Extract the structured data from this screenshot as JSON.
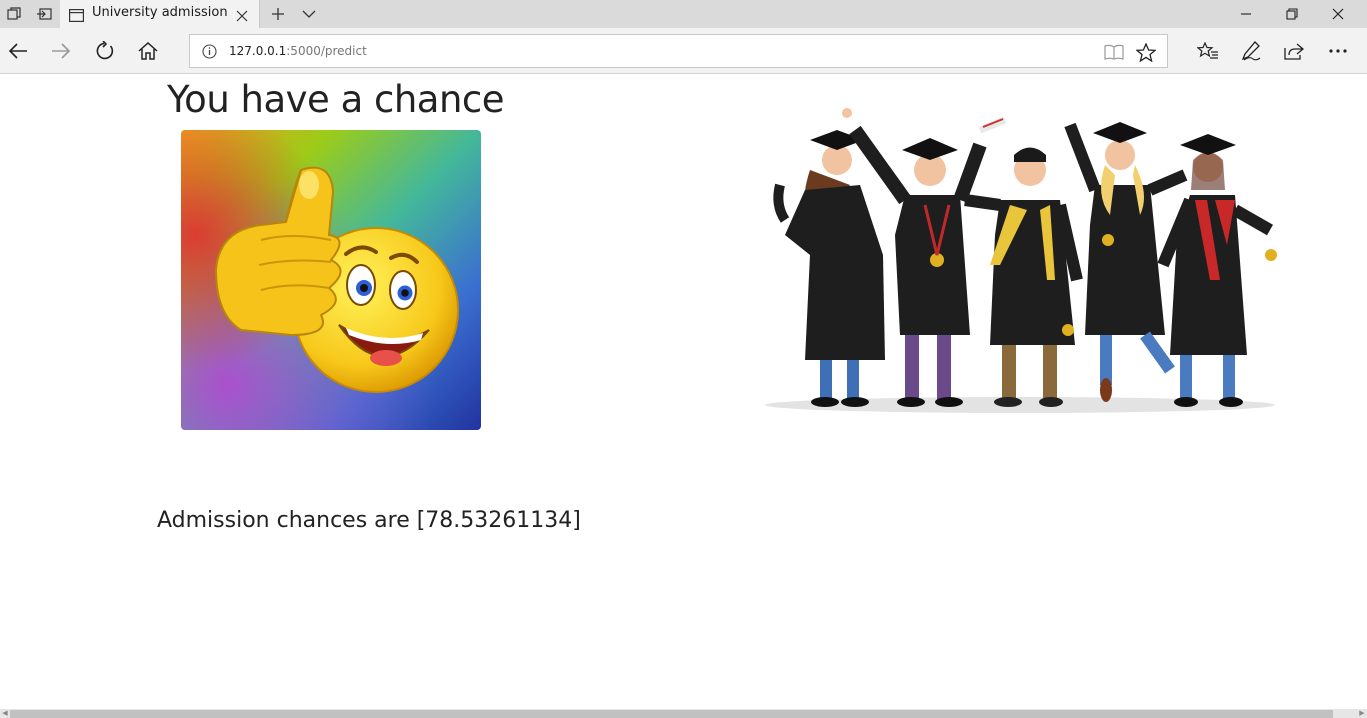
{
  "browser": {
    "tab": {
      "title": "University admission pr"
    },
    "address_bar": {
      "host": "127.0.0.1",
      "path": ":5000/predict"
    }
  },
  "icons": {
    "tab_actions": "tab-actions-icon",
    "set_aside": "set-aside-tabs-icon",
    "favicon": "page-icon",
    "close_tab": "close-icon",
    "new_tab": "plus-icon",
    "tab_preview": "chevron-down-icon",
    "minimize": "minimize-icon",
    "maximize": "restore-icon",
    "close_window": "close-icon",
    "back": "back-arrow-icon",
    "forward": "forward-arrow-icon",
    "refresh": "refresh-icon",
    "home": "home-icon",
    "info": "info-icon",
    "reading_view": "book-icon",
    "favorite": "star-icon",
    "favorites_hub": "favorites-list-icon",
    "notes": "pen-icon",
    "share": "share-icon",
    "more": "more-icon"
  },
  "page": {
    "heading": "You have a chance",
    "result_text": "Admission chances are [78.53261134]"
  },
  "colors": {
    "chrome_bg": "#f2f2f2",
    "tabstrip_bg": "#dadada",
    "emoji_yellow": "#f7c81a"
  }
}
